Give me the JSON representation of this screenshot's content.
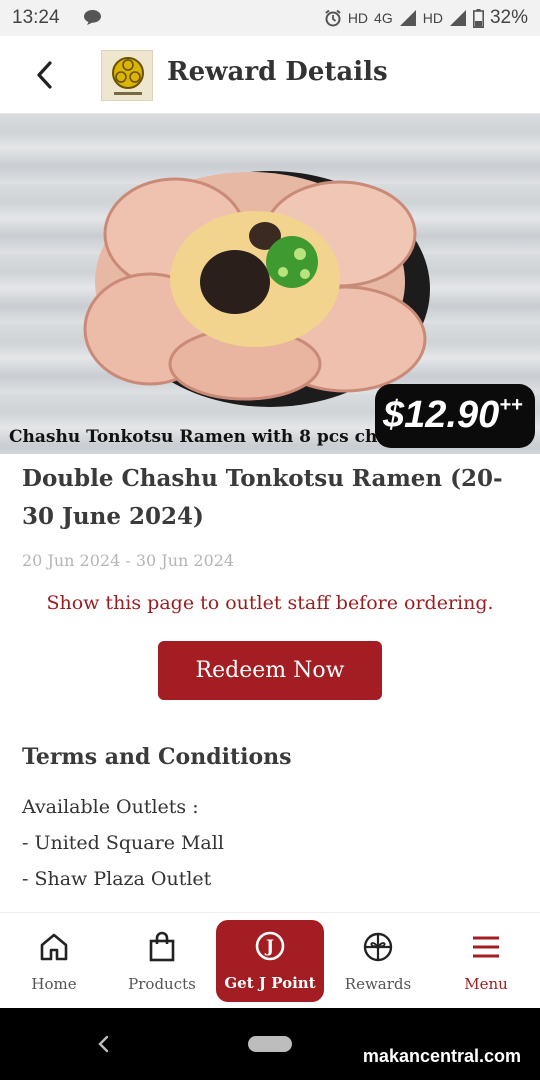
{
  "status_bar": {
    "time": "13:24",
    "indicators": "HD",
    "network": "4G",
    "indicators2": "HD",
    "battery": "32%"
  },
  "header": {
    "title": "Reward Details",
    "back_icon": "chevron-left-icon",
    "logo_icon": "brand-crest-logo"
  },
  "hero": {
    "caption": "Chashu Tonkotsu Ramen with 8 pcs chashu.",
    "price": "$12.90",
    "price_suffix": "++"
  },
  "reward": {
    "title": "Double Chashu Tonkotsu Ramen (20- 30 June 2024)",
    "dates": "20 Jun 2024 - 30 Jun 2024",
    "notice": "Show this page to outlet staff before ordering.",
    "redeem_label": "Redeem Now"
  },
  "terms": {
    "title": "Terms and Conditions",
    "lines": [
      "Available Outlets :",
      "- United Square Mall",
      "- Shaw Plaza Outlet"
    ]
  },
  "bottom_nav": {
    "items": [
      {
        "label": "Home",
        "icon": "home-icon"
      },
      {
        "label": "Products",
        "icon": "shopping-bag-icon"
      },
      {
        "label": "Get J Point",
        "icon": "j-point-icon"
      },
      {
        "label": "Rewards",
        "icon": "gift-icon"
      },
      {
        "label": "Menu",
        "icon": "hamburger-menu-icon"
      }
    ]
  },
  "watermark": "makancentral.com",
  "colors": {
    "accent": "#a31d22",
    "notice": "#9b1c1f",
    "muted": "#b5b5b5"
  }
}
